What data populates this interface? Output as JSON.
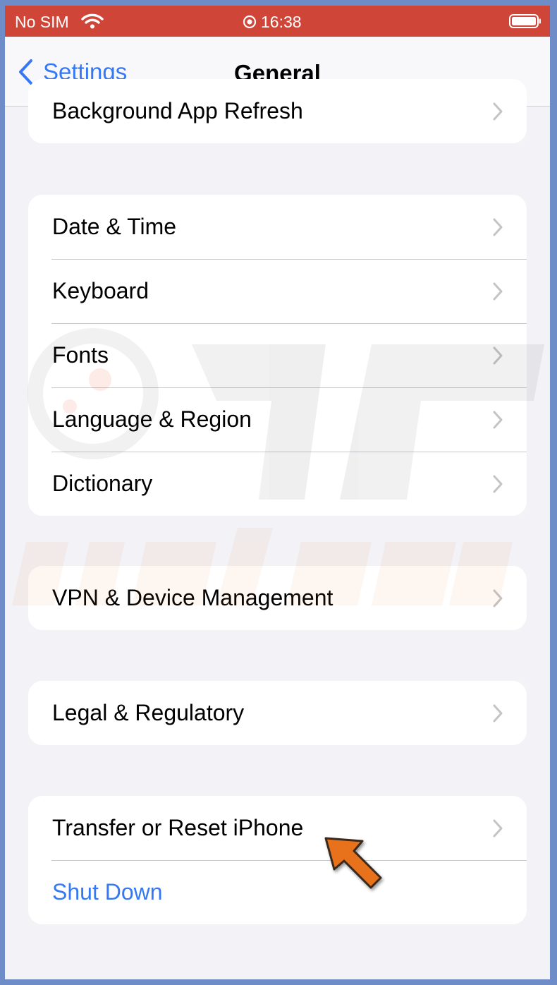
{
  "status_bar": {
    "carrier": "No SIM",
    "time": "16:38"
  },
  "nav": {
    "back_label": "Settings",
    "title": "General"
  },
  "groups": [
    {
      "rows": [
        {
          "label": "Background App Refresh"
        }
      ]
    },
    {
      "rows": [
        {
          "label": "Date & Time"
        },
        {
          "label": "Keyboard"
        },
        {
          "label": "Fonts"
        },
        {
          "label": "Language & Region"
        },
        {
          "label": "Dictionary"
        }
      ]
    },
    {
      "rows": [
        {
          "label": "VPN & Device Management"
        }
      ]
    },
    {
      "rows": [
        {
          "label": "Legal & Regulatory"
        }
      ]
    },
    {
      "rows": [
        {
          "label": "Transfer or Reset iPhone"
        },
        {
          "label": "Shut Down"
        }
      ]
    }
  ],
  "colors": {
    "status_bar": "#cf4638",
    "accent": "#3478f6",
    "background": "#f2f2f7",
    "annotation_arrow": "#e8721f",
    "frame": "#6d8cc8"
  },
  "icons": [
    "wifi-icon",
    "alarm-icon",
    "battery-icon",
    "back-chevron-icon",
    "chevron-right-icon",
    "annotation-arrow"
  ]
}
